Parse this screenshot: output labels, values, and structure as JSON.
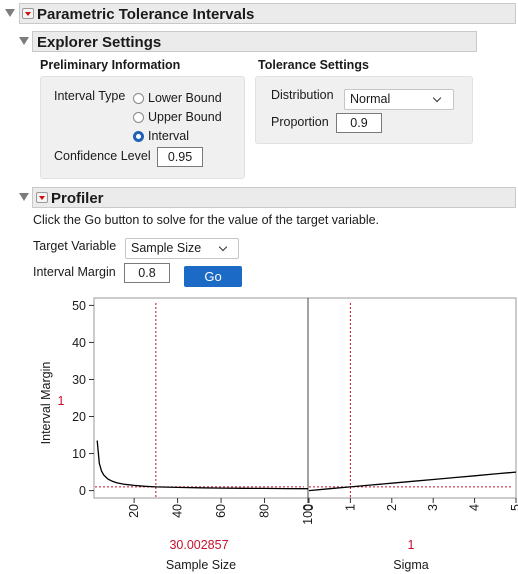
{
  "header": {
    "title": "Parametric Tolerance Intervals"
  },
  "explorer": {
    "title": "Explorer Settings",
    "preliminary": {
      "title": "Preliminary Information",
      "interval_type_label": "Interval Type",
      "options": [
        "Lower Bound",
        "Upper Bound",
        "Interval"
      ],
      "selected": "Interval",
      "confidence_label": "Confidence Level",
      "confidence_value": "0.95"
    },
    "tolerance": {
      "title": "Tolerance Settings",
      "distribution_label": "Distribution",
      "distribution_value": "Normal",
      "proportion_label": "Proportion",
      "proportion_value": "0.9"
    }
  },
  "profiler": {
    "title": "Profiler",
    "instruction": "Click the Go button to solve for the value of the target variable.",
    "target_label": "Target Variable",
    "target_value": "Sample Size",
    "margin_label": "Interval Margin",
    "margin_value": "0.8",
    "go_label": "Go",
    "current_response": "1",
    "colors": {
      "reference": "#c8102e",
      "curve": "#000000",
      "accent": "#1b6ac6"
    }
  },
  "chart_data": [
    {
      "type": "line",
      "ylabel": "Interval Margin",
      "xlabel": "Sample Size",
      "xlim": [
        2,
        100
      ],
      "ylim": [
        -2,
        52
      ],
      "x_ticks": [
        "20",
        "40",
        "60",
        "80",
        "100"
      ],
      "y_ticks": [
        "0",
        "10",
        "20",
        "30",
        "40",
        "50"
      ],
      "current_x": "30.002857",
      "current_y": 1,
      "series": [
        {
          "x": [
            3,
            4,
            5,
            6,
            8,
            10,
            12,
            15,
            20,
            25,
            30,
            40,
            50,
            60,
            70,
            80,
            90,
            100
          ],
          "values": [
            13.5,
            7.4,
            5.3,
            4.2,
            3.1,
            2.5,
            2.1,
            1.75,
            1.4,
            1.15,
            1.0,
            0.85,
            0.75,
            0.68,
            0.63,
            0.58,
            0.55,
            0.52
          ]
        }
      ]
    },
    {
      "type": "line",
      "xlabel": "Sigma",
      "xlim": [
        0,
        5
      ],
      "ylim": [
        -2,
        52
      ],
      "x_ticks": [
        "0",
        "1",
        "2",
        "3",
        "4",
        "5"
      ],
      "current_x": "1",
      "current_y": 1,
      "series": [
        {
          "x": [
            0,
            0.5,
            1,
            1.5,
            2,
            2.5,
            3,
            3.5,
            4,
            4.5,
            5
          ],
          "values": [
            0,
            0.5,
            1,
            1.5,
            2,
            2.5,
            3,
            3.5,
            4,
            4.5,
            5
          ]
        }
      ]
    }
  ]
}
